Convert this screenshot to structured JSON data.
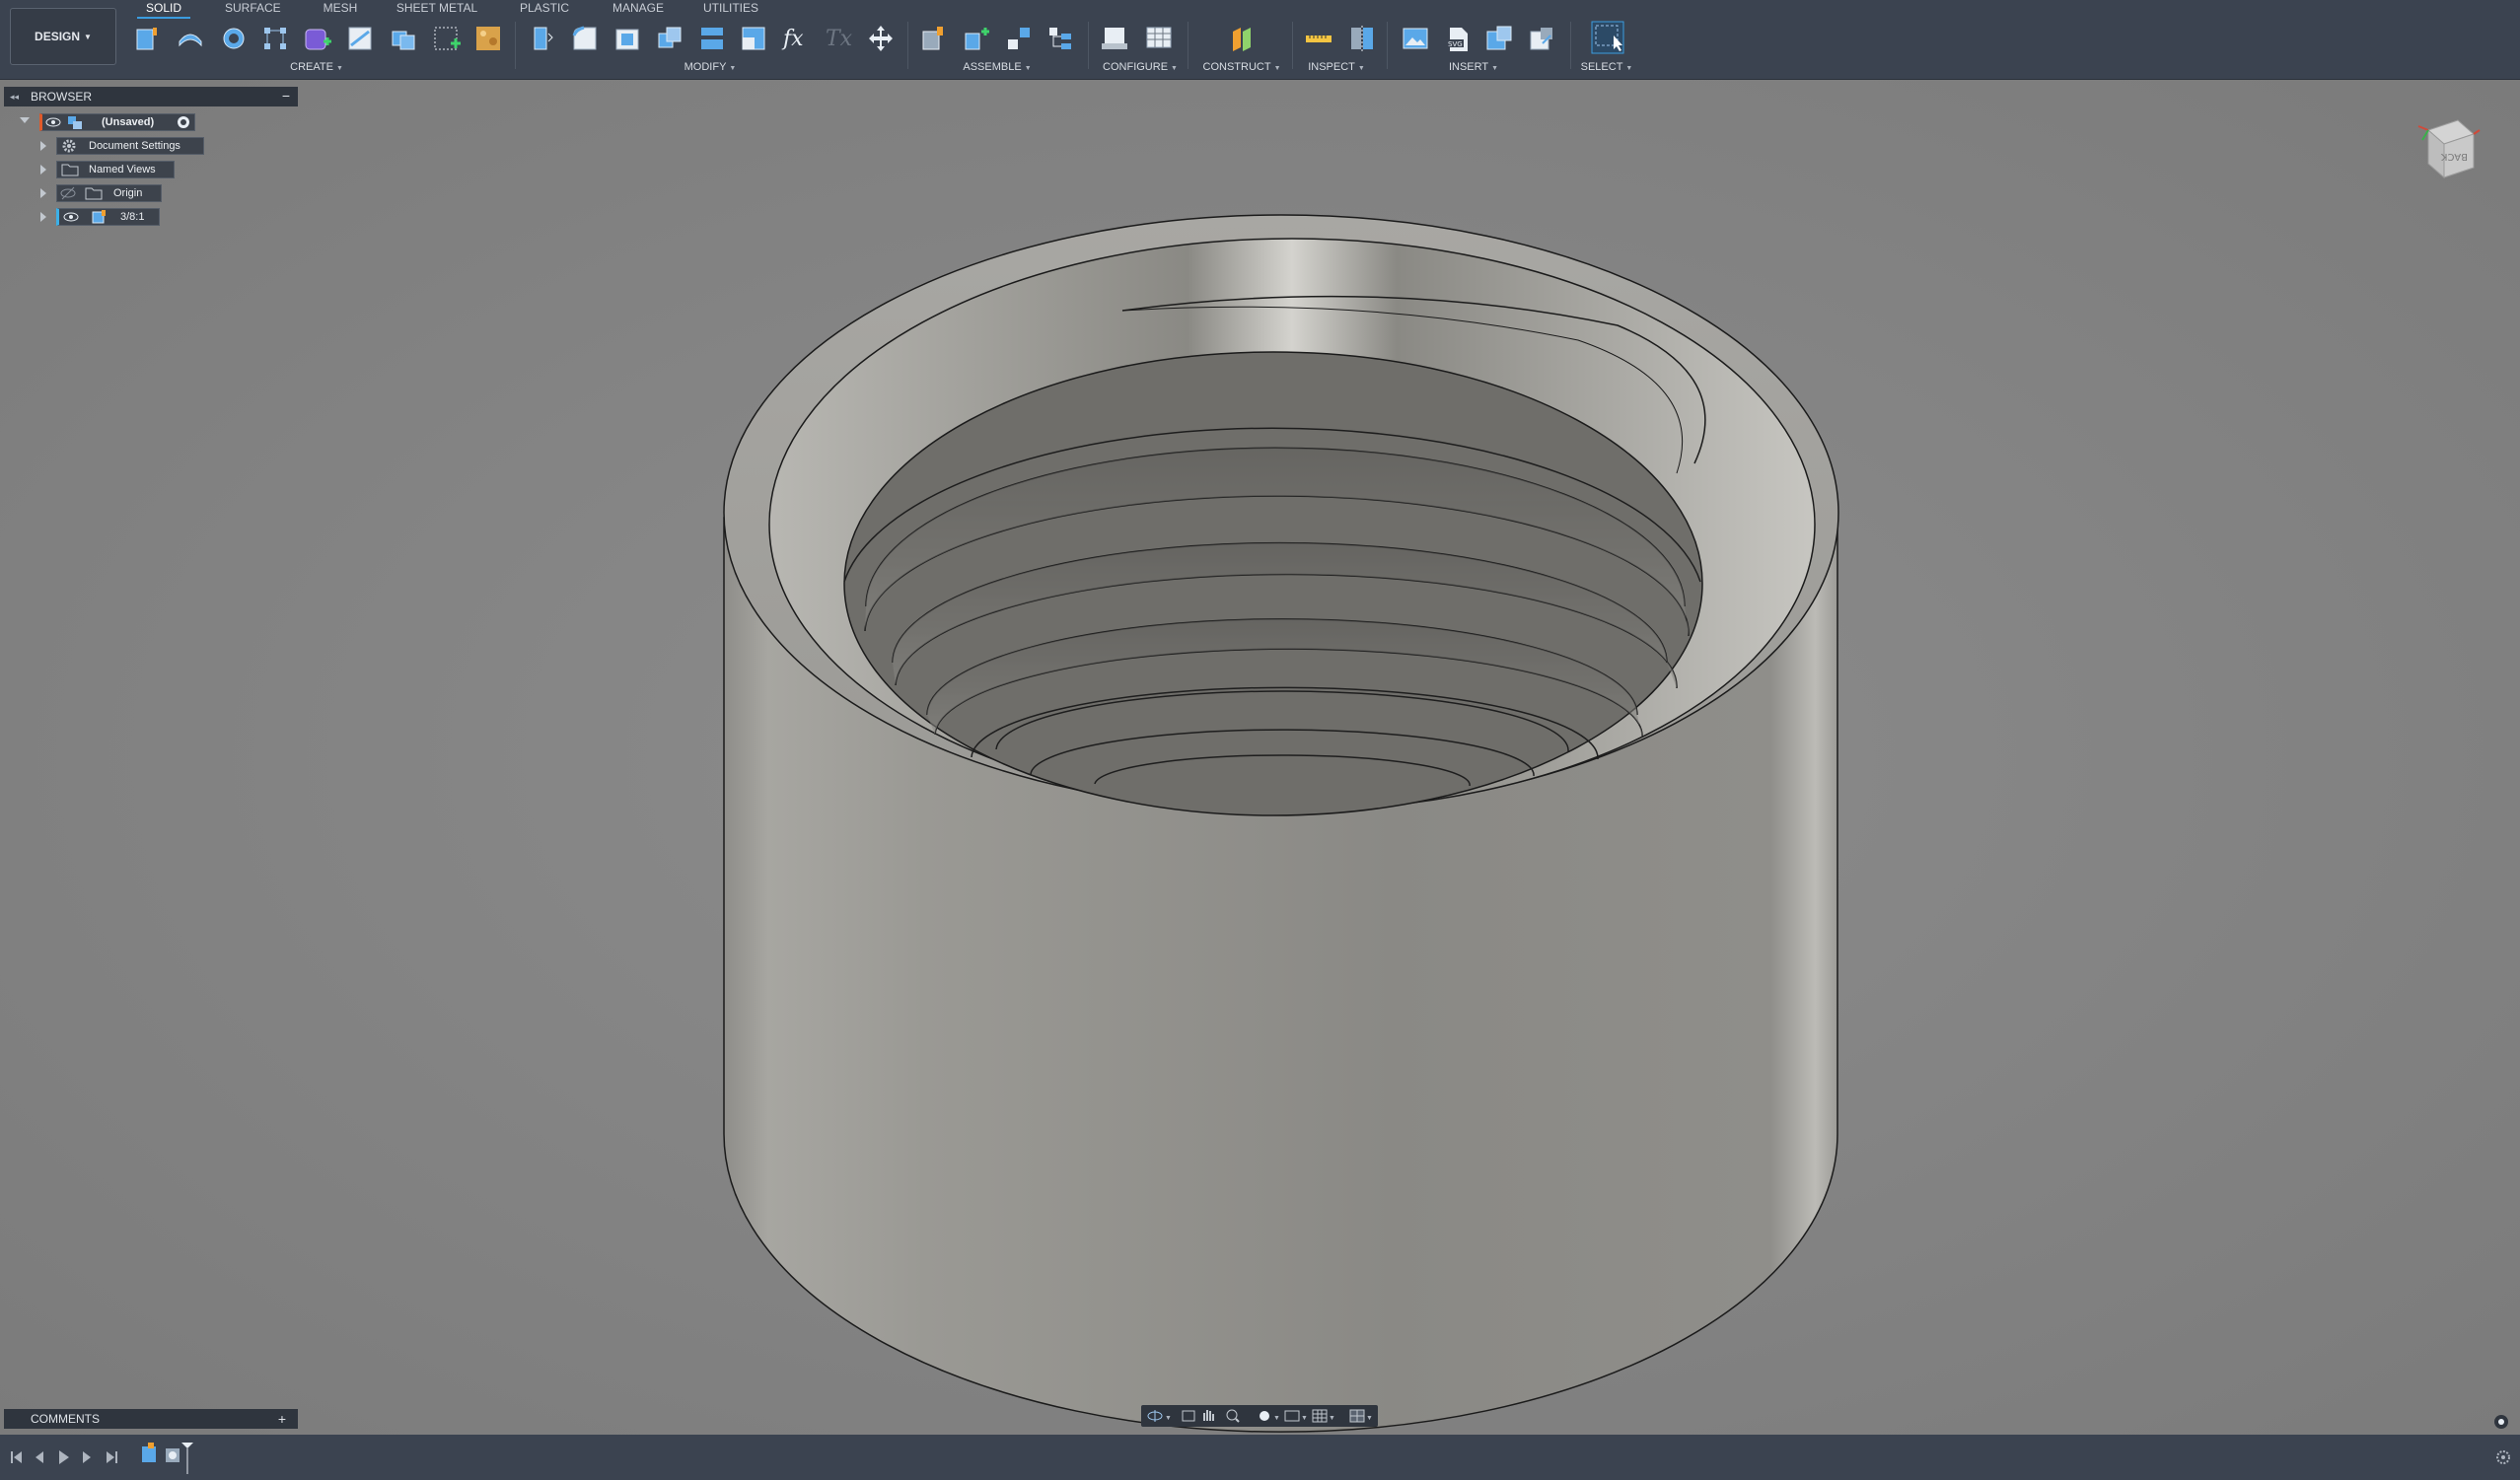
{
  "app": {
    "mode_button": "DESIGN"
  },
  "tabs": [
    "SOLID",
    "SURFACE",
    "MESH",
    "SHEET METAL",
    "PLASTIC",
    "MANAGE",
    "UTILITIES"
  ],
  "active_tab": "SOLID",
  "groups": {
    "create": "CREATE",
    "modify": "MODIFY",
    "assemble": "ASSEMBLE",
    "configure": "CONFIGURE",
    "construct": "CONSTRUCT",
    "inspect": "INSPECT",
    "insert": "INSERT",
    "select": "SELECT"
  },
  "browser": {
    "title": "BROWSER",
    "items": [
      {
        "label": "(Unsaved)",
        "icon": "component-icon"
      },
      {
        "label": "Document Settings",
        "icon": "gear-icon"
      },
      {
        "label": "Named Views",
        "icon": "folder-icon"
      },
      {
        "label": "Origin",
        "icon": "folder-icon"
      },
      {
        "label": "3/8:1",
        "icon": "body-icon"
      }
    ]
  },
  "comments": {
    "title": "COMMENTS"
  },
  "viewcube": {
    "face_label": "BACK"
  },
  "colors": {
    "toolbar_bg": "#3b4350",
    "panel_bg": "#2f353e",
    "viewport_bg": "#808080",
    "accent": "#3b9cdf",
    "create_accent": "#7a5bd6"
  }
}
